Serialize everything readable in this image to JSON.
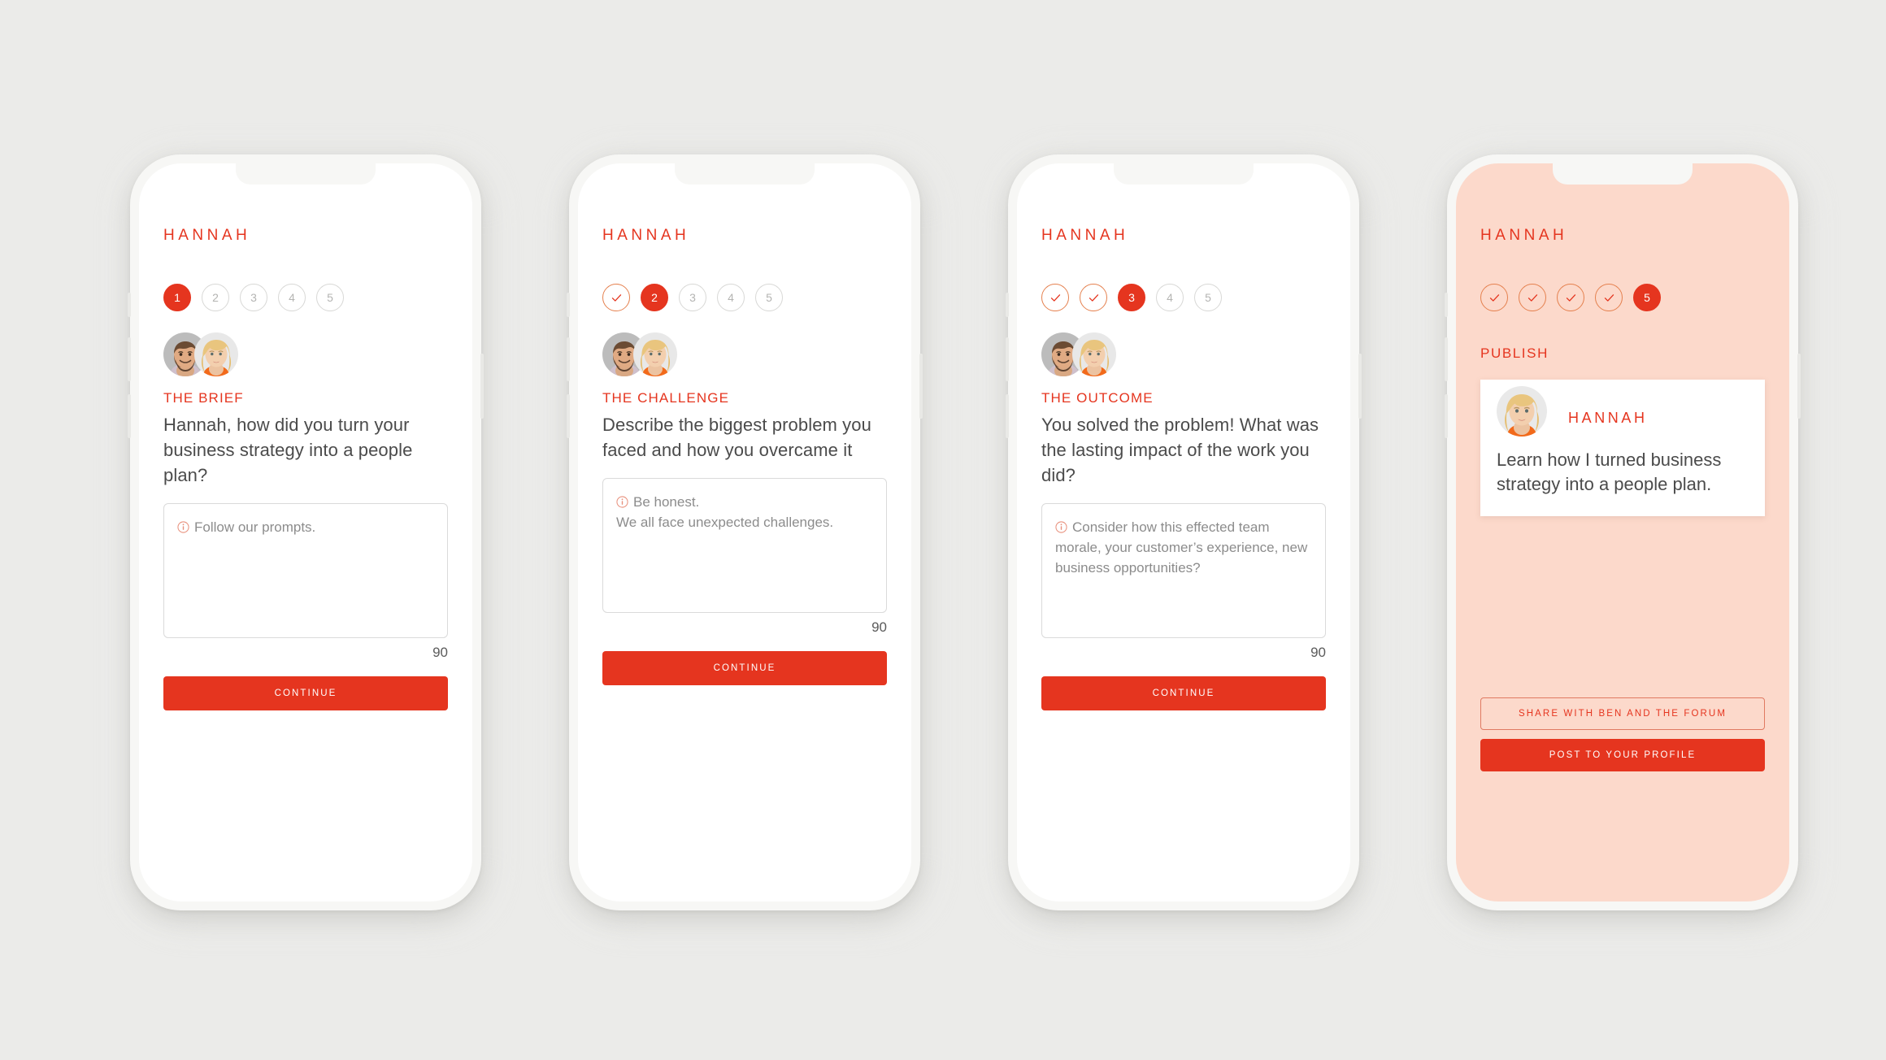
{
  "meta": {
    "background_color": "#ebebe9",
    "accent_color": "#e5351f",
    "pink_screen_color": "#fcd9cb",
    "text_color": "#4b4b4b",
    "hint_color": "#8c8c8c"
  },
  "screens": [
    {
      "id": "brief",
      "brand": "HANNAH",
      "steps": [
        {
          "label": "1",
          "state": "active"
        },
        {
          "label": "2",
          "state": "todo"
        },
        {
          "label": "3",
          "state": "todo"
        },
        {
          "label": "4",
          "state": "todo"
        },
        {
          "label": "5",
          "state": "todo"
        }
      ],
      "eyebrow": "THE BRIEF",
      "question": "Hannah, how did you turn your business strategy into a people plan?",
      "hint": "Follow our prompts.",
      "answer_value": "",
      "counter": "90",
      "primary_button": "CONTINUE"
    },
    {
      "id": "challenge",
      "brand": "HANNAH",
      "steps": [
        {
          "label": "1",
          "state": "done"
        },
        {
          "label": "2",
          "state": "active"
        },
        {
          "label": "3",
          "state": "todo"
        },
        {
          "label": "4",
          "state": "todo"
        },
        {
          "label": "5",
          "state": "todo"
        }
      ],
      "eyebrow": "THE CHALLENGE",
      "question": "Describe the biggest problem you faced and how you overcame it",
      "hint": "Be honest.\nWe all face unexpected challenges.",
      "answer_value": "",
      "counter": "90",
      "primary_button": "CONTINUE"
    },
    {
      "id": "outcome",
      "brand": "HANNAH",
      "steps": [
        {
          "label": "1",
          "state": "done"
        },
        {
          "label": "2",
          "state": "done"
        },
        {
          "label": "3",
          "state": "active"
        },
        {
          "label": "4",
          "state": "todo"
        },
        {
          "label": "5",
          "state": "todo"
        }
      ],
      "eyebrow": "THE OUTCOME",
      "question": "You solved the problem! What was the lasting impact of the work you did?",
      "hint": "Consider how this effected team morale, your customer’s experience, new business opportunities?",
      "answer_value": "",
      "counter": "90",
      "primary_button": "CONTINUE"
    },
    {
      "id": "publish",
      "brand": "HANNAH",
      "steps": [
        {
          "label": "1",
          "state": "done"
        },
        {
          "label": "2",
          "state": "done"
        },
        {
          "label": "3",
          "state": "done"
        },
        {
          "label": "4",
          "state": "done"
        },
        {
          "label": "5",
          "state": "active"
        }
      ],
      "section_label": "PUBLISH",
      "card": {
        "name": "HANNAH",
        "text": "Learn how I turned business strategy into a people plan."
      },
      "share_button": "SHARE WITH BEN AND THE FORUM",
      "post_button": "POST TO YOUR PROFILE"
    }
  ],
  "icons": {
    "info": "info-circle-icon",
    "check": "check-icon"
  }
}
